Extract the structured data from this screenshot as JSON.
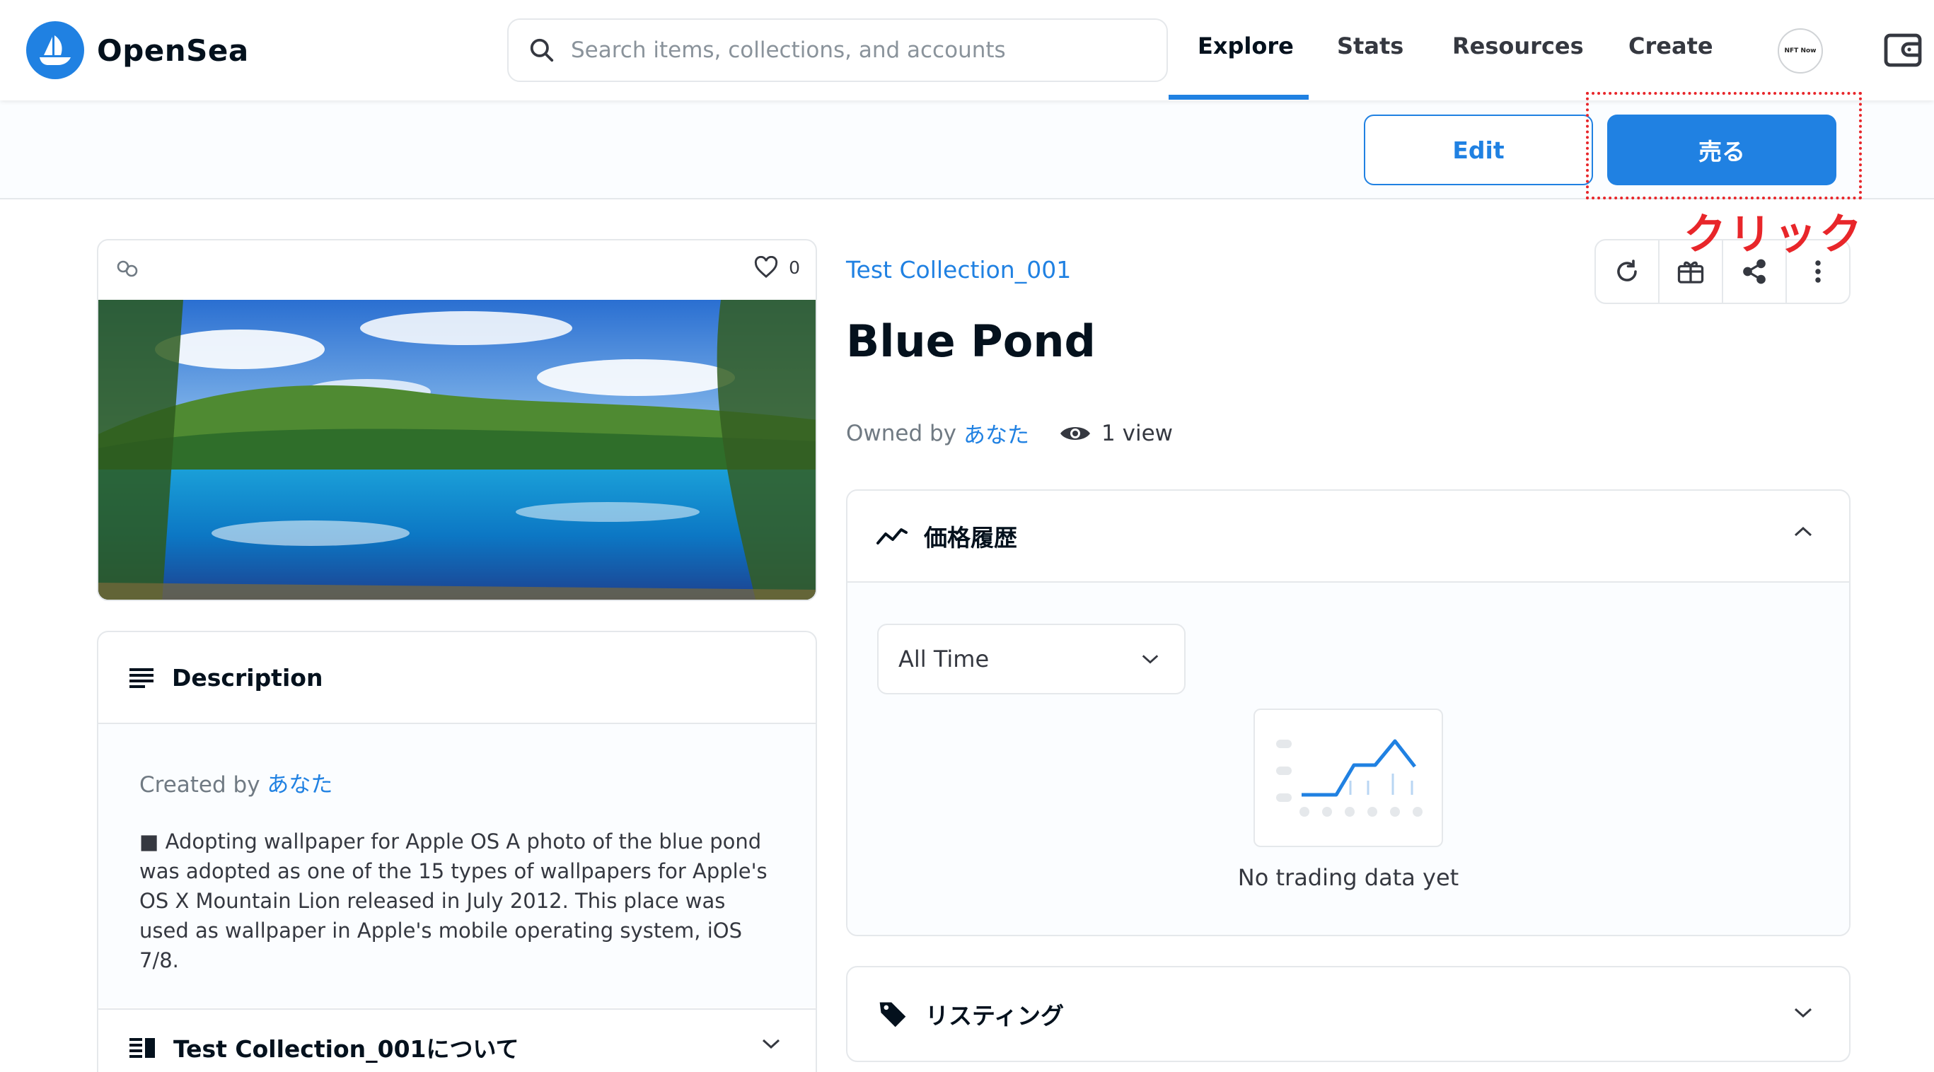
{
  "header": {
    "brand": "OpenSea",
    "search_placeholder": "Search items, collections, and accounts",
    "nav": [
      "Explore",
      "Stats",
      "Resources",
      "Create"
    ],
    "active_nav": "Explore",
    "avatar_text": "NFT Now"
  },
  "subbar": {
    "edit_label": "Edit",
    "sell_label": "売る"
  },
  "annotation": {
    "text": "クリック",
    "color": "#e8262a"
  },
  "asset": {
    "like_count": "0",
    "collection": "Test Collection_001",
    "title": "Blue Pond",
    "owned_by_label": "Owned by",
    "owner": "あなた",
    "views": "1 view"
  },
  "description": {
    "heading": "Description",
    "created_by_label": "Created by",
    "creator": "あなた",
    "text": "■ Adopting wallpaper for Apple OS A photo of the blue pond was adopted as one of the 15 types of wallpapers for Apple's OS X Mountain Lion released in July 2012. This place was used as wallpaper in Apple's mobile operating system, iOS 7/8.",
    "about_heading": "Test Collection_001について"
  },
  "price_history": {
    "heading": "価格履歴",
    "range_selected": "All Time",
    "empty_text": "No trading data yet"
  },
  "listing": {
    "heading": "リスティング"
  },
  "colors": {
    "accent": "#2081e2",
    "text": "#04111d",
    "border": "#e5e8eb"
  }
}
